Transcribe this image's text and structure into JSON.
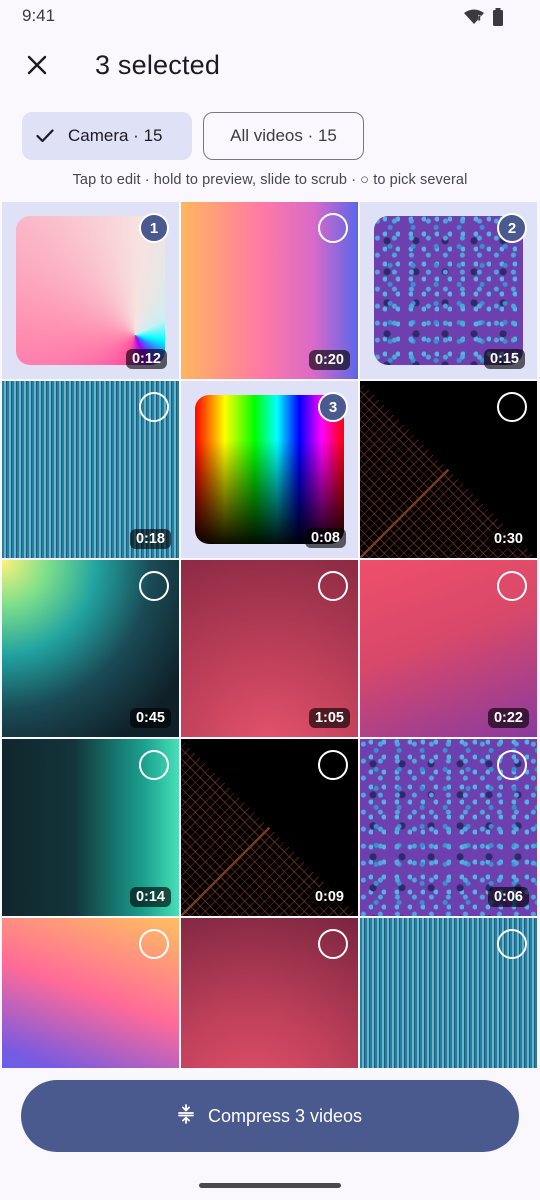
{
  "status": {
    "time": "9:41"
  },
  "header": {
    "title": "3 selected",
    "close_icon": "close-icon"
  },
  "filters": {
    "camera": "Camera · 15",
    "all_videos": "All videos · 15"
  },
  "hint": "Tap to edit · hold to preview, slide to scrub · ○ to pick several",
  "tiles": [
    {
      "duration": "0:12",
      "selected": true,
      "order": "1",
      "texture": "pink-cone"
    },
    {
      "duration": "0:20",
      "selected": false,
      "order": "",
      "texture": "sunset"
    },
    {
      "duration": "0:15",
      "selected": true,
      "order": "2",
      "texture": "purple-noise"
    },
    {
      "duration": "0:18",
      "selected": false,
      "order": "",
      "texture": "teal-stripes"
    },
    {
      "duration": "0:08",
      "selected": true,
      "order": "3",
      "texture": "rainbow"
    },
    {
      "duration": "0:30",
      "selected": false,
      "order": "",
      "texture": "sierpinski"
    },
    {
      "duration": "0:45",
      "selected": false,
      "order": "",
      "texture": "aurora"
    },
    {
      "duration": "1:05",
      "selected": false,
      "order": "",
      "texture": "rose"
    },
    {
      "duration": "0:22",
      "selected": false,
      "order": "",
      "texture": "rose-purple"
    },
    {
      "duration": "0:14",
      "selected": false,
      "order": "",
      "texture": "teal-dark"
    },
    {
      "duration": "0:09",
      "selected": false,
      "order": "",
      "texture": "sierpinski"
    },
    {
      "duration": "0:06",
      "selected": false,
      "order": "",
      "texture": "purple-noise"
    },
    {
      "duration": "",
      "selected": false,
      "order": "",
      "texture": "pink-blue"
    },
    {
      "duration": "",
      "selected": false,
      "order": "",
      "texture": "crimson"
    },
    {
      "duration": "",
      "selected": false,
      "order": "",
      "texture": "teal-stripes"
    }
  ],
  "action": {
    "compress_label": "Compress 3 videos"
  },
  "colors": {
    "accent": "#4a5a8f",
    "chip_selected": "#dfe1f7",
    "background": "#fbf8fd"
  }
}
